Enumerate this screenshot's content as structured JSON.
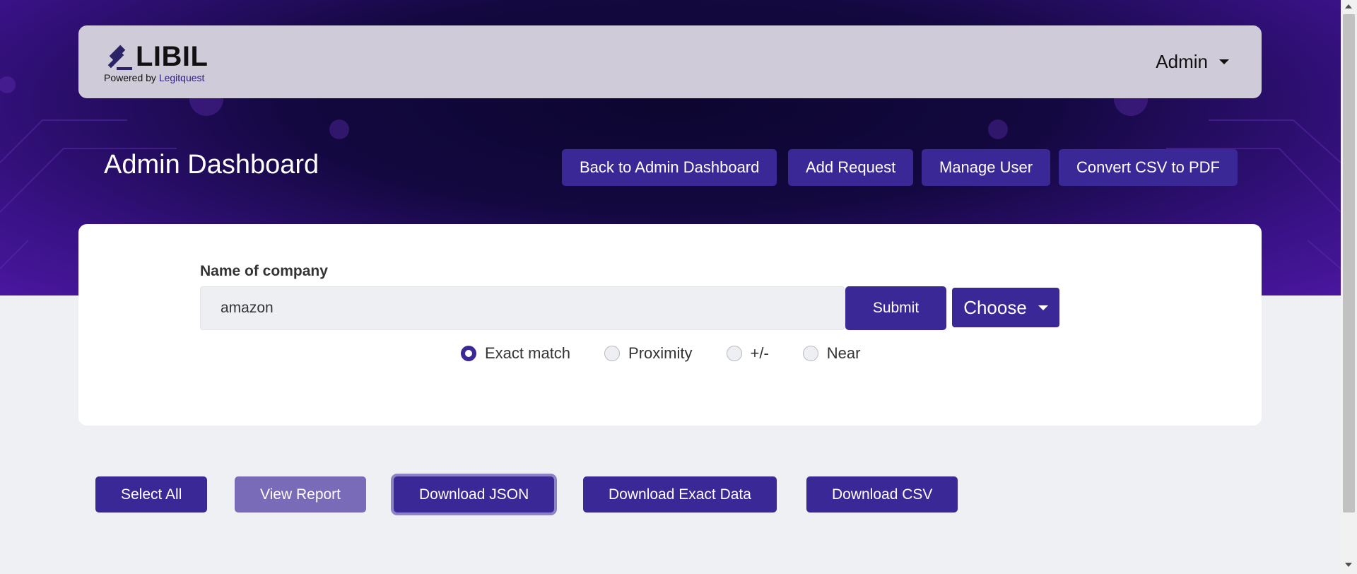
{
  "navbar": {
    "logo_text": "LIBIL",
    "powered_prefix": "Powered by",
    "powered_brand": "Legitquest",
    "user_menu_label": "Admin"
  },
  "header": {
    "title": "Admin Dashboard",
    "buttons": {
      "back": "Back to Admin Dashboard",
      "add_request": "Add Request",
      "manage_user": "Manage User",
      "convert": "Convert CSV to PDF"
    }
  },
  "search": {
    "label": "Name of company",
    "value": "amazon",
    "submit_label": "Submit",
    "choose_label": "Choose",
    "match_options": [
      {
        "label": "Exact match",
        "checked": true
      },
      {
        "label": "Proximity",
        "checked": false
      },
      {
        "label": "+/-",
        "checked": false
      },
      {
        "label": "Near",
        "checked": false
      }
    ]
  },
  "actions": {
    "select_all": "Select All",
    "view_report": "View Report",
    "download_json": "Download JSON",
    "download_exact": "Download Exact Data",
    "download_csv": "Download CSV"
  },
  "colors": {
    "primary": "#3b2897",
    "primary_light": "#7a6bb8",
    "hero_dark": "#0d0630",
    "hero_purple": "#4a169e"
  },
  "icons": {
    "logo": "gavel-icon"
  }
}
